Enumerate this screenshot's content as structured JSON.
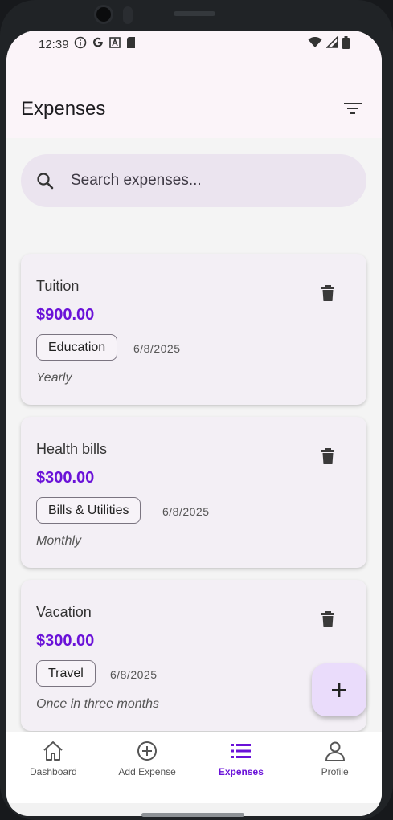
{
  "status_bar": {
    "time": "12:39",
    "left_icons": [
      "info-icon",
      "google-icon",
      "font-icon",
      "sdcard-icon"
    ],
    "right_icons": [
      "wifi-icon",
      "signal-icon",
      "battery-icon"
    ]
  },
  "app_bar": {
    "title": "Expenses",
    "filter_icon": "filter-icon"
  },
  "search": {
    "placeholder": "Search expenses...",
    "value": ""
  },
  "expenses": [
    {
      "title": "Tuition",
      "amount": "$900.00",
      "category": "Education",
      "date": "6/8/2025",
      "frequency": "Yearly"
    },
    {
      "title": "Health bills",
      "amount": "$300.00",
      "category": "Bills & Utilities",
      "date": "6/8/2025",
      "frequency": "Monthly"
    },
    {
      "title": "Vacation",
      "amount": "$300.00",
      "category": "Travel",
      "date": "6/8/2025",
      "frequency": "Once in three months"
    }
  ],
  "fab": {
    "icon": "plus-icon"
  },
  "bottom_nav": [
    {
      "label": "Dashboard",
      "icon": "home-icon",
      "active": false
    },
    {
      "label": "Add Expense",
      "icon": "add-circle-icon",
      "active": false
    },
    {
      "label": "Expenses",
      "icon": "list-icon",
      "active": true
    },
    {
      "label": "Profile",
      "icon": "person-icon",
      "active": false
    }
  ],
  "colors": {
    "accent": "#6a12d8",
    "app_bar_bg": "#fbf4f9",
    "search_bg": "#ebe4ef",
    "card_bg": "#f3eff5",
    "fab_bg": "#eadcfb"
  }
}
